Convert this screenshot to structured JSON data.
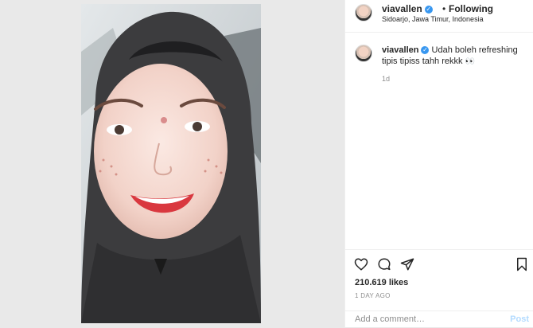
{
  "post": {
    "username": "viavallen",
    "follow_dot": "•",
    "follow_label": "Following",
    "location": "Sidoarjo, Jawa Timur, Indonesia",
    "caption_text": "Udah boleh refreshing tipis tipiss tahh rekkk",
    "caption_emoji": "👀",
    "caption_age": "1d",
    "likes": "210.619 likes",
    "posted": "1 DAY AGO",
    "comment_placeholder": "Add a comment…",
    "post_label": "Post"
  },
  "icons": {
    "like": "heart-icon",
    "comment": "comment-icon",
    "share": "share-icon",
    "save": "bookmark-icon",
    "verified": "verified-icon"
  },
  "colors": {
    "verified": "#3897f0",
    "post_disabled": "#b3dbff",
    "secondary_text": "#8e8e8e"
  }
}
